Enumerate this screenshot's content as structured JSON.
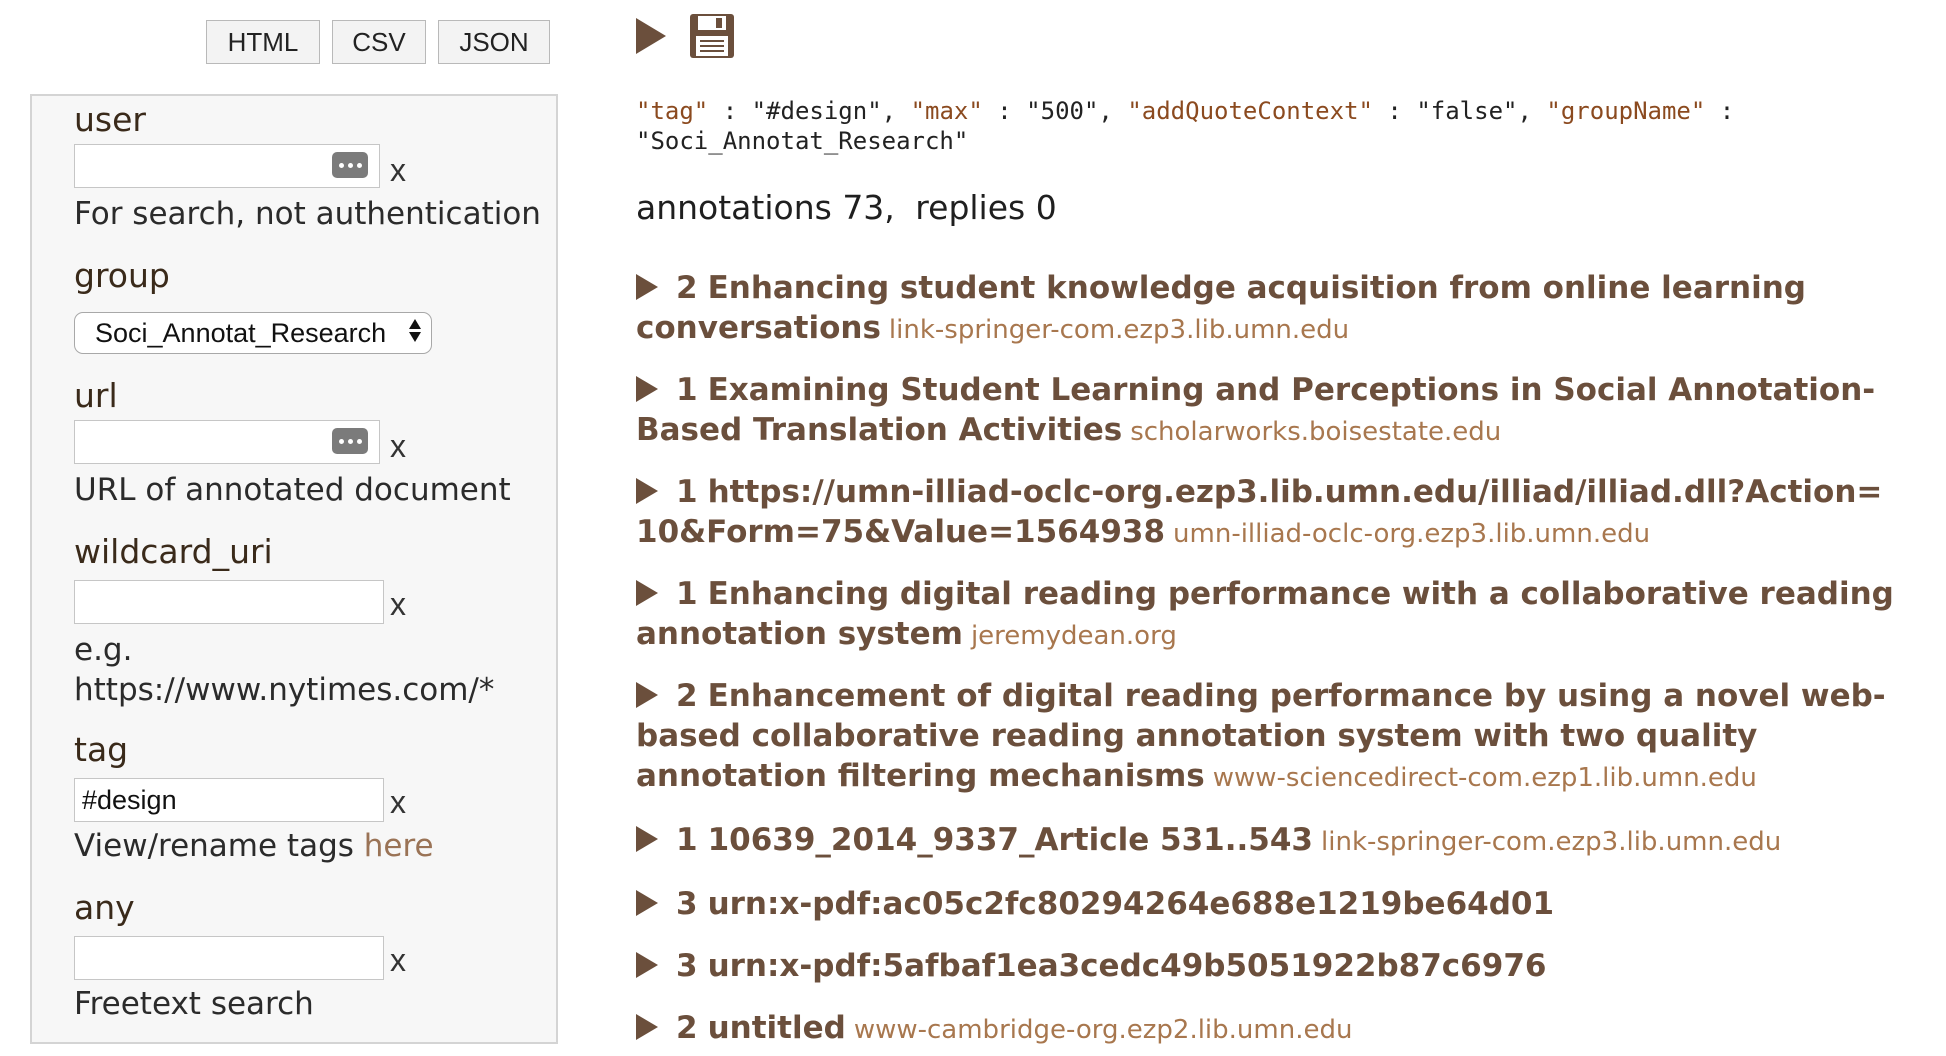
{
  "export": {
    "html": "HTML",
    "csv": "CSV",
    "json": "JSON"
  },
  "form": {
    "user": {
      "label": "user",
      "value": "",
      "help": "For search, not authentication"
    },
    "group": {
      "label": "group",
      "selected": "Soci_Annotat_Research"
    },
    "url": {
      "label": "url",
      "value": "",
      "help": "URL of annotated document"
    },
    "wildcard_uri": {
      "label": "wildcard_uri",
      "value": "",
      "help_line1": "e.g.",
      "help_line2": "https://www.nytimes.com/*"
    },
    "tag": {
      "label": "tag",
      "value": "#design",
      "help_prefix": "View/rename tags",
      "help_link": "here"
    },
    "any": {
      "label": "any",
      "value": "",
      "help": "Freetext search"
    },
    "clear": "x"
  },
  "query": [
    {
      "key": "\"tag\"",
      "value": "\"#design\""
    },
    {
      "key": "\"max\"",
      "value": "\"500\""
    },
    {
      "key": "\"addQuoteContext\"",
      "value": "\"false\""
    },
    {
      "key": "\"groupName\"",
      "value": "\"Soci_Annotat_Research\""
    }
  ],
  "summary": {
    "annotations_label": "annotations",
    "annotations": "73,",
    "replies_label": "replies",
    "replies": "0"
  },
  "results": [
    {
      "count": "2",
      "title": "Enhancing student knowledge acquisition from online learning conversations",
      "host": "link-springer-com.ezp3.lib.umn.edu"
    },
    {
      "count": "1",
      "title": "Examining Student Learning and Perceptions in Social Annotation-Based Translation Activities",
      "host": "scholarworks.boisestate.edu"
    },
    {
      "count": "1",
      "title": "https://umn-illiad-oclc-org.ezp3.lib.umn.edu/illiad/illiad.dll?Action=10&Form=75&Value=1564938",
      "host": "umn-illiad-oclc-org.ezp3.lib.umn.edu"
    },
    {
      "count": "1",
      "title": "Enhancing digital reading performance with a collaborative reading annotation system",
      "host": "jeremydean.org"
    },
    {
      "count": "2",
      "title": "Enhancement of digital reading performance by using a novel web-based collaborative reading annotation system with two quality annotation filtering mechanisms",
      "host": "www-sciencedirect-com.ezp1.lib.umn.edu"
    },
    {
      "count": "1",
      "title": "10639_2014_9337_Article 531..543",
      "host": "link-springer-com.ezp3.lib.umn.edu"
    },
    {
      "count": "3",
      "title": "urn:x-pdf:ac05c2fc80294264e688e1219be64d01",
      "host": ""
    },
    {
      "count": "3",
      "title": "urn:x-pdf:5afbaf1ea3cedc49b5051922b87c6976",
      "host": ""
    },
    {
      "count": "2",
      "title": "untitled",
      "host": "www-cambridge-org.ezp2.lib.umn.edu"
    }
  ],
  "colors": {
    "accent": "#6b4f3c",
    "host": "#a8774e",
    "json_key": "#8b4a1f"
  },
  "icons": {
    "run": "play-icon",
    "save": "floppy-disk-icon",
    "expand": "triangle-right-icon",
    "password": "keyring-icon"
  }
}
